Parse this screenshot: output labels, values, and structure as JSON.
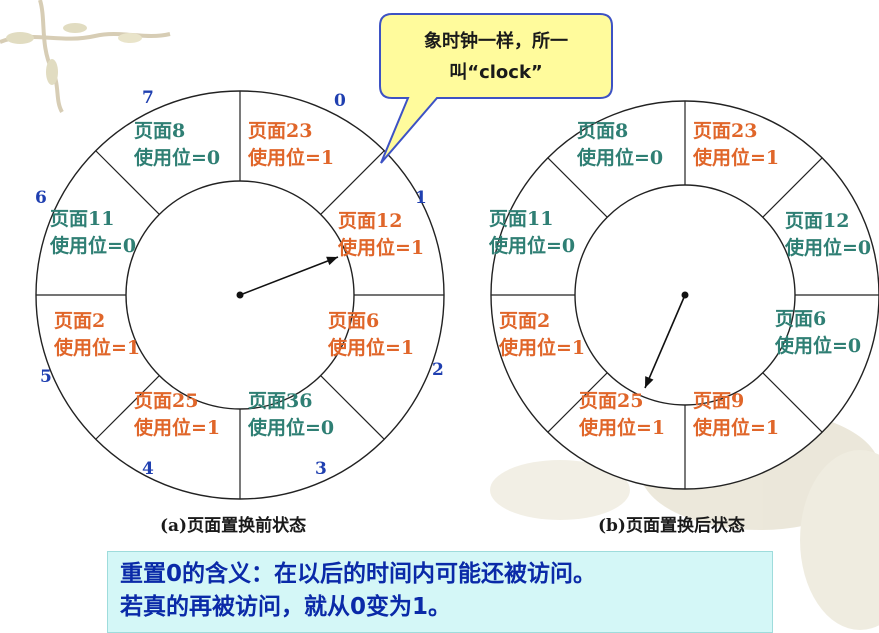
{
  "callout": {
    "line1": "象时钟一样，所一",
    "line2": "叫“clock”"
  },
  "clock_a": {
    "caption": "(a)页面置换前状态",
    "slot_numbers": [
      "0",
      "1",
      "2",
      "3",
      "4",
      "5",
      "6",
      "7"
    ],
    "cells": [
      {
        "page": "页面23",
        "bit": "使用位=1",
        "color": "#e0662a"
      },
      {
        "page": "页面12",
        "bit": "使用位=1",
        "color": "#e0662a"
      },
      {
        "page": "页面6",
        "bit": "使用位=1",
        "color": "#e0662a"
      },
      {
        "page": "页面36",
        "bit": "使用位=0",
        "color": "#2f7f74"
      },
      {
        "page": "页面25",
        "bit": "使用位=1",
        "color": "#e0662a"
      },
      {
        "page": "页面2",
        "bit": "使用位=1",
        "color": "#e0662a"
      },
      {
        "page": "页面11",
        "bit": "使用位=0",
        "color": "#2f7f74"
      },
      {
        "page": "页面8",
        "bit": "使用位=0",
        "color": "#2f7f74"
      }
    ],
    "pointer_slot": 1
  },
  "clock_b": {
    "caption": "(b)页面置换后状态",
    "cells": [
      {
        "page": "页面23",
        "bit": "使用位=1",
        "color": "#e0662a"
      },
      {
        "page": "页面12",
        "bit": "使用位=0",
        "color": "#2f7f74"
      },
      {
        "page": "页面6",
        "bit": "使用位=0",
        "color": "#2f7f74"
      },
      {
        "page": "页面9",
        "bit": "使用位=1",
        "color": "#e0662a"
      },
      {
        "page": "页面25",
        "bit": "使用位=1",
        "color": "#e0662a"
      },
      {
        "page": "页面2",
        "bit": "使用位=1",
        "color": "#e0662a"
      },
      {
        "page": "页面11",
        "bit": "使用位=0",
        "color": "#2f7f74"
      },
      {
        "page": "页面8",
        "bit": "使用位=0",
        "color": "#2f7f74"
      }
    ],
    "pointer_slot": 4
  },
  "note": {
    "line1": "重置0的含义：在以后的时间内可能还被访问。",
    "line2": "若真的再被访问，就从0变为1。"
  },
  "colors": {
    "used": "#e0662a",
    "unused": "#2f7f74",
    "slot_number": "#1f3fb0",
    "note_bg": "#d4f7f7",
    "note_text": "#0a2aa8",
    "callout_bg": "#fffb9c"
  }
}
